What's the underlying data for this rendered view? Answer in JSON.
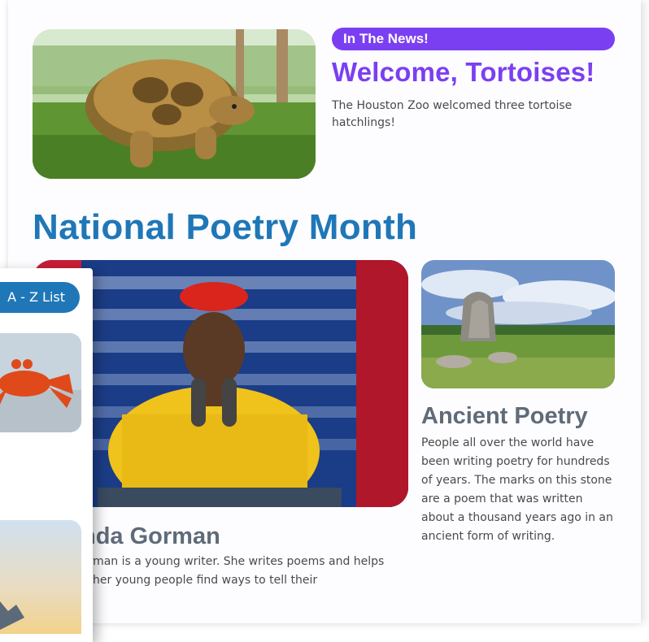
{
  "news": {
    "badge": "In The News!",
    "title": "Welcome, Tortoises!",
    "description": "The Houston Zoo welcomed three tortoise hatchlings!"
  },
  "poetry": {
    "section_title": "National Poetry Month",
    "feature": {
      "title": "nda Gorman",
      "description": "orman is a young writer. She writes poems and  helps other young people find ways to tell their"
    },
    "side": {
      "title": "Ancient Poetry",
      "description": "People all over the world have been writing poetry for hundreds of years. The marks on this stone are a poem that was written about a thousand years ago in an ancient form of writing."
    }
  },
  "overlay": {
    "list_button": "A - Z List"
  },
  "colors": {
    "purple": "#7b3ff2",
    "blue": "#1f77b8",
    "gray_heading": "#5f6b78"
  }
}
